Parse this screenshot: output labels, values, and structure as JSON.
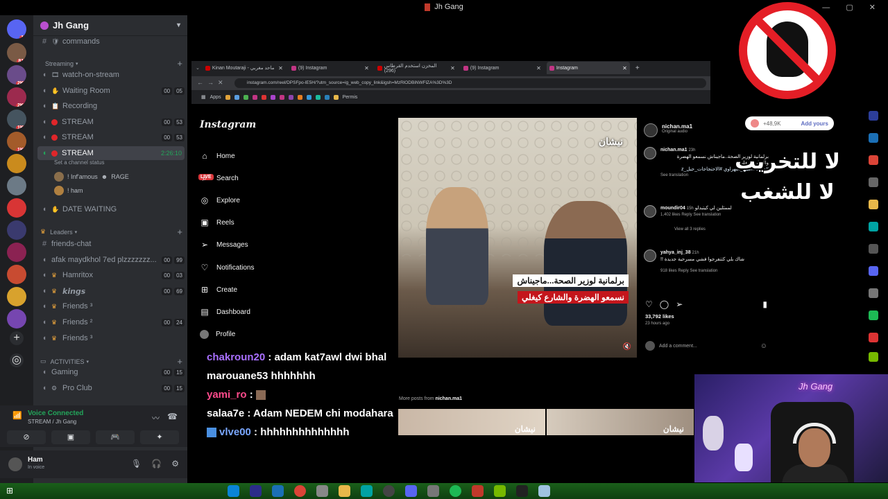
{
  "window": {
    "title": "Jh Gang"
  },
  "discord": {
    "guild": "Jh Gang",
    "channels": [
      {
        "icon": "#",
        "emoji": "🛡",
        "label": "commands"
      },
      {
        "category": "Streaming"
      },
      {
        "icon": "voice",
        "emoji": "🎞",
        "label": "watch-on-stream"
      },
      {
        "icon": "voice",
        "emoji": "✋",
        "label": "Waiting Room",
        "counts": [
          "00",
          "05"
        ]
      },
      {
        "icon": "voice",
        "emoji": "📋",
        "label": "Recording"
      },
      {
        "icon": "voice",
        "emoji": "🔴",
        "label": "STREAM",
        "counts": [
          "00",
          "53"
        ]
      },
      {
        "icon": "voice",
        "emoji": "🔴",
        "label": "STREAM",
        "counts": [
          "00",
          "53"
        ]
      },
      {
        "icon": "voice",
        "emoji": "🔴",
        "label": "STREAM",
        "time": "2:26:10",
        "active": true
      }
    ],
    "set_status": "Set a channel status",
    "voice_users": [
      {
        "name": "! Inf'amous",
        "extra": "RAGE",
        "live": "LIVE"
      },
      {
        "name": "! ham"
      }
    ],
    "more_channels": [
      {
        "icon": "voice",
        "emoji": "✋",
        "label": "DATE WAITING"
      },
      {
        "category": "Leaders"
      },
      {
        "icon": "#",
        "label": "friends-chat"
      },
      {
        "icon": "voice",
        "label": "afak maydkhol 7ed plzzzzzzz...",
        "counts": [
          "00",
          "99"
        ]
      },
      {
        "icon": "voice",
        "emoji": "👑",
        "label": "Hamritox",
        "counts": [
          "00",
          "03"
        ]
      },
      {
        "icon": "voice",
        "emoji": "👑",
        "label": "𝙠𝙞𝙣𝙜𝙨",
        "counts": [
          "00",
          "69"
        ]
      },
      {
        "icon": "voice",
        "emoji": "👑",
        "label": "Friends ³"
      },
      {
        "icon": "voice",
        "emoji": "👑",
        "label": "Friends ²",
        "counts": [
          "00",
          "24"
        ]
      },
      {
        "icon": "voice",
        "emoji": "👑",
        "label": "Friends ³"
      },
      {
        "category": "ACTIVITIES"
      },
      {
        "icon": "voice",
        "label": "Gaming",
        "counts": [
          "00",
          "15"
        ]
      },
      {
        "icon": "voice",
        "emoji": "⚙",
        "label": "Pro Club",
        "counts": [
          "00",
          "15"
        ]
      }
    ],
    "voice_connected": {
      "title": "Voice Connected",
      "sub": "STREAM / Jh Gang"
    },
    "user": {
      "name": "Ham",
      "status": "In voice"
    }
  },
  "browser": {
    "tabs": [
      {
        "label": "Kinan Moutaraji - ماحد مغربي"
      },
      {
        "label": "(9) Instagram"
      },
      {
        "label": "المخزن استخدم القرطاس (296)"
      },
      {
        "label": "(9) Instagram"
      },
      {
        "label": "Instagram",
        "active": true
      }
    ],
    "url": "instagram.com/reel/DPSFpo-lE5H/?utm_source=ig_web_copy_link&igsh=MzRlODBiNWFlZA%3D%3D",
    "bookmarks": [
      "Apps",
      "Permis"
    ]
  },
  "instagram": {
    "logo": "Instagram",
    "nav": [
      {
        "icon": "home-icon",
        "glyph": "⌂",
        "label": "Home"
      },
      {
        "icon": "search-icon",
        "glyph": "⌕",
        "label": "Search"
      },
      {
        "icon": "explore-icon",
        "glyph": "◎",
        "label": "Explore"
      },
      {
        "icon": "reels-icon",
        "glyph": "▣",
        "label": "Reels"
      },
      {
        "icon": "messages-icon",
        "glyph": "➢",
        "label": "Messages"
      },
      {
        "icon": "notifications-icon",
        "glyph": "♡",
        "label": "Notifications"
      },
      {
        "icon": "create-icon",
        "glyph": "⊞",
        "label": "Create"
      },
      {
        "icon": "dashboard-icon",
        "glyph": "▤",
        "label": "Dashboard"
      },
      {
        "icon": "profile-icon",
        "glyph": "",
        "label": "Profile"
      }
    ],
    "video": {
      "watermark": "نيشان",
      "caption1": "برلمانية لوزير الصحة...ماجيناش",
      "caption2": "نسمعو الهضرة والشارع كيغلي"
    },
    "post": {
      "user": "nichan.ma1",
      "audio": "Original audio",
      "comments": [
        {
          "user": "nichan.ma1",
          "age": "23h",
          "text": "برلمانية لوزير الصحة..ماجيناش نسمعو الهضرة والشارع كيغلي",
          "tags": "#صحة #أمين_التهراوي #الاحتجاجات_جيل_z",
          "meta": "See translation"
        },
        {
          "user": "moundir04",
          "age": "15h",
          "text": "لممثلين لي كيتبدلو",
          "meta": "1,402 likes  Reply  See translation",
          "replies": "View all 3 replies"
        },
        {
          "user": "yahya_inj_38",
          "age": "21h",
          "text": "شاك بلي كتتفرجوا فشي مسرحية جديدة !!",
          "meta": "918 likes  Reply  See translation"
        }
      ],
      "likes": "33,792 likes",
      "ago": "23 hours ago",
      "add_comment": "Add a comment..."
    },
    "more_posts_label": "More posts from",
    "more_posts_user": "nichan.ma1",
    "thumb_text": "نيشان"
  },
  "chat_overlay": [
    {
      "user": "chakroun20",
      "msg": "adam kat7awl dwi bhal marouane53 hhhhhhh"
    },
    {
      "user": "yami_ro",
      "msg": ""
    },
    {
      "user": "salaa7e",
      "msg": "Adam NEDEM chi modahara"
    },
    {
      "user": "vlve00",
      "msg": "hhhhhhhhhhhhhh"
    }
  ],
  "overlay": {
    "pill_count": "+48,9K",
    "pill_action": "Add yours",
    "arabic_line1": "لا للتخريب",
    "arabic_line2": "لا للشغب",
    "webcam_neon": "Jh Gang"
  },
  "colors": {
    "discord_bg": "#2b2d31",
    "accent_green": "#23a55a",
    "ig_bg": "#000000",
    "stop_red": "#e41e26"
  }
}
